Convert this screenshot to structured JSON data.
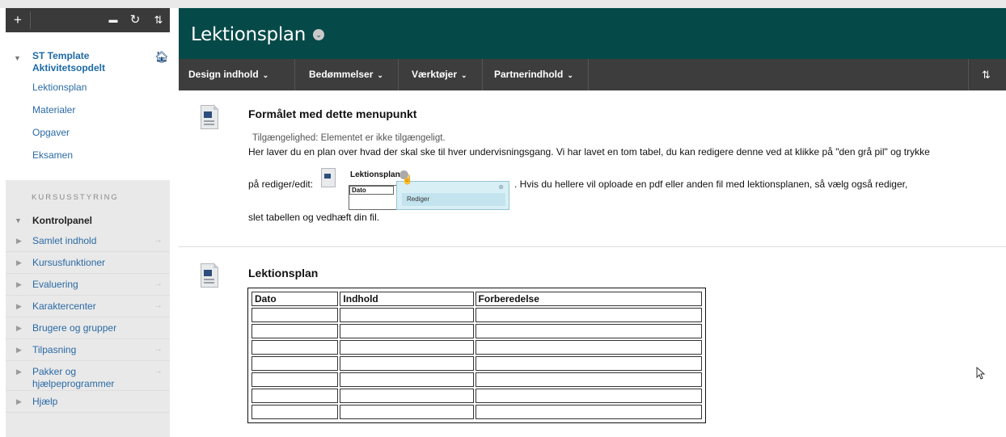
{
  "sidebar": {
    "toolbar": {
      "add_glyph": "+",
      "folder_glyph": "▬",
      "refresh_glyph": "↻",
      "sort_glyph": "⇅"
    },
    "course": {
      "title": "ST Template Aktivitetsopdelt",
      "items": [
        {
          "label": "Lektionsplan"
        },
        {
          "label": "Materialer"
        },
        {
          "label": "Opgaver"
        },
        {
          "label": "Eksamen"
        }
      ]
    },
    "management": {
      "heading": "KURSUSSTYRING",
      "control_panel": "Kontrolpanel",
      "items": [
        {
          "label": "Samlet indhold",
          "arrow": "→"
        },
        {
          "label": "Kursusfunktioner",
          "arrow": ""
        },
        {
          "label": "Evaluering",
          "arrow": "→"
        },
        {
          "label": "Karaktercenter",
          "arrow": "→"
        },
        {
          "label": "Brugere og grupper",
          "arrow": ""
        },
        {
          "label": "Tilpasning",
          "arrow": "→"
        },
        {
          "label": "Pakker og hjælpeprogrammer",
          "arrow": "→"
        },
        {
          "label": "Hjælp",
          "arrow": ""
        }
      ]
    }
  },
  "header": {
    "title": "Lektionsplan"
  },
  "menubar": {
    "items": [
      {
        "label": "Design indhold"
      },
      {
        "label": "Bedømmelser"
      },
      {
        "label": "Værktøjer"
      },
      {
        "label": "Partnerindhold"
      }
    ],
    "chevron": "⌄",
    "sort_glyph": "⇅"
  },
  "items": [
    {
      "title": "Formålet med dette menupunkt",
      "availability": "Tilgængelighed:  Elementet er ikke tilgængeligt.",
      "line1": "Her laver du en plan over hvad der skal ske til hver undervisningsgang. Vi har lavet en tom tabel, du kan redigere denne ved at klikke på \"den grå pil\" og trykke",
      "line2_before": "på rediger/edit:",
      "line2_after": ". Hvis du hellere vil oploade en pdf eller anden fil med lektionsplanen, så vælg også rediger,",
      "line3": "slet tabellen og vedhæft din fil.",
      "inline_image": {
        "title": "Lektionsplan",
        "col": "Dato",
        "menu_option": "Rediger"
      }
    },
    {
      "title": "Lektionsplan",
      "table": {
        "headers": [
          "Dato",
          "Indhold",
          "Forberedelse"
        ],
        "rows": [
          [
            "",
            "",
            ""
          ],
          [
            "",
            "",
            ""
          ],
          [
            "",
            "",
            ""
          ],
          [
            "",
            "",
            ""
          ],
          [
            "",
            "",
            ""
          ],
          [
            "",
            "",
            ""
          ],
          [
            "",
            "",
            ""
          ]
        ]
      }
    }
  ],
  "colors": {
    "header_bg": "#054a48",
    "menubar_bg": "#3d3d3d",
    "sidebar_toolbar_bg": "#3a3a3a",
    "link": "#2a6aa5"
  }
}
